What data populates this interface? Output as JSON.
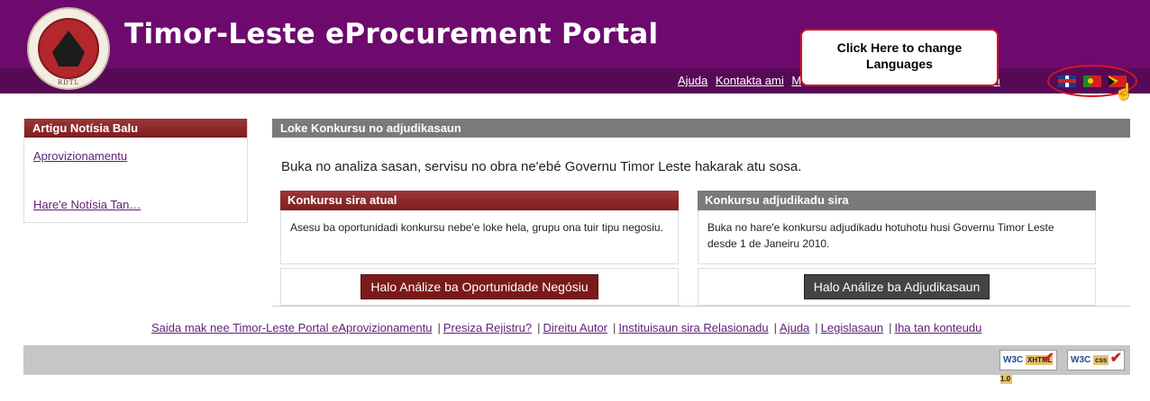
{
  "header": {
    "title": "Timor-Leste eProcurement Portal",
    "seal_text": "RDTL",
    "nav": [
      "Ajuda",
      "Kontakta ami",
      "M",
      "tin"
    ],
    "callout": "Click Here to change Languages",
    "languages": [
      "English",
      "Português",
      "Tetun"
    ]
  },
  "sidebar": {
    "heading": "Artigu Notísia Balu",
    "links": [
      "Aprovizionamentu",
      "Hare'e Notísia Tan…"
    ]
  },
  "main": {
    "heading": "Loke Konkursu no adjudikasaun",
    "intro": "Buka no analiza sasan, servisu no obra ne'ebé Governu Timor Leste hakarak atu sosa.",
    "current": {
      "heading": "Konkursu sira atual",
      "body": "Asesu ba oportunidadi konkursu nebe'e loke hela, grupu ona tuir tipu negosiu.",
      "button": "Halo Análize ba Oportunidade Negósiu"
    },
    "awarded": {
      "heading": "Konkursu adjudikadu sira",
      "body": "Buka no hare'e konkursu adjudikadu hotuhotu husi Governu Timor Leste desde 1 de Janeiru 2010.",
      "button": "Halo Análize ba Adjudikasaun"
    }
  },
  "footer": {
    "links": [
      "Saida mak nee Timor-Leste Portal eAprovizionamentu",
      "Presiza Rejistru?",
      "Direitu Autor",
      "Instituisaun sira Relasionadu",
      "Ajuda",
      "Legislasaun",
      "Iha tan konteudu"
    ],
    "badges": [
      {
        "w3c": "W3C",
        "tag": "XHTML 1.0"
      },
      {
        "w3c": "W3C",
        "tag": "css"
      }
    ]
  },
  "colors": {
    "header": "#6e0a6e",
    "accent_red": "#7a1a1a",
    "grey_head": "#7a7a7a"
  }
}
